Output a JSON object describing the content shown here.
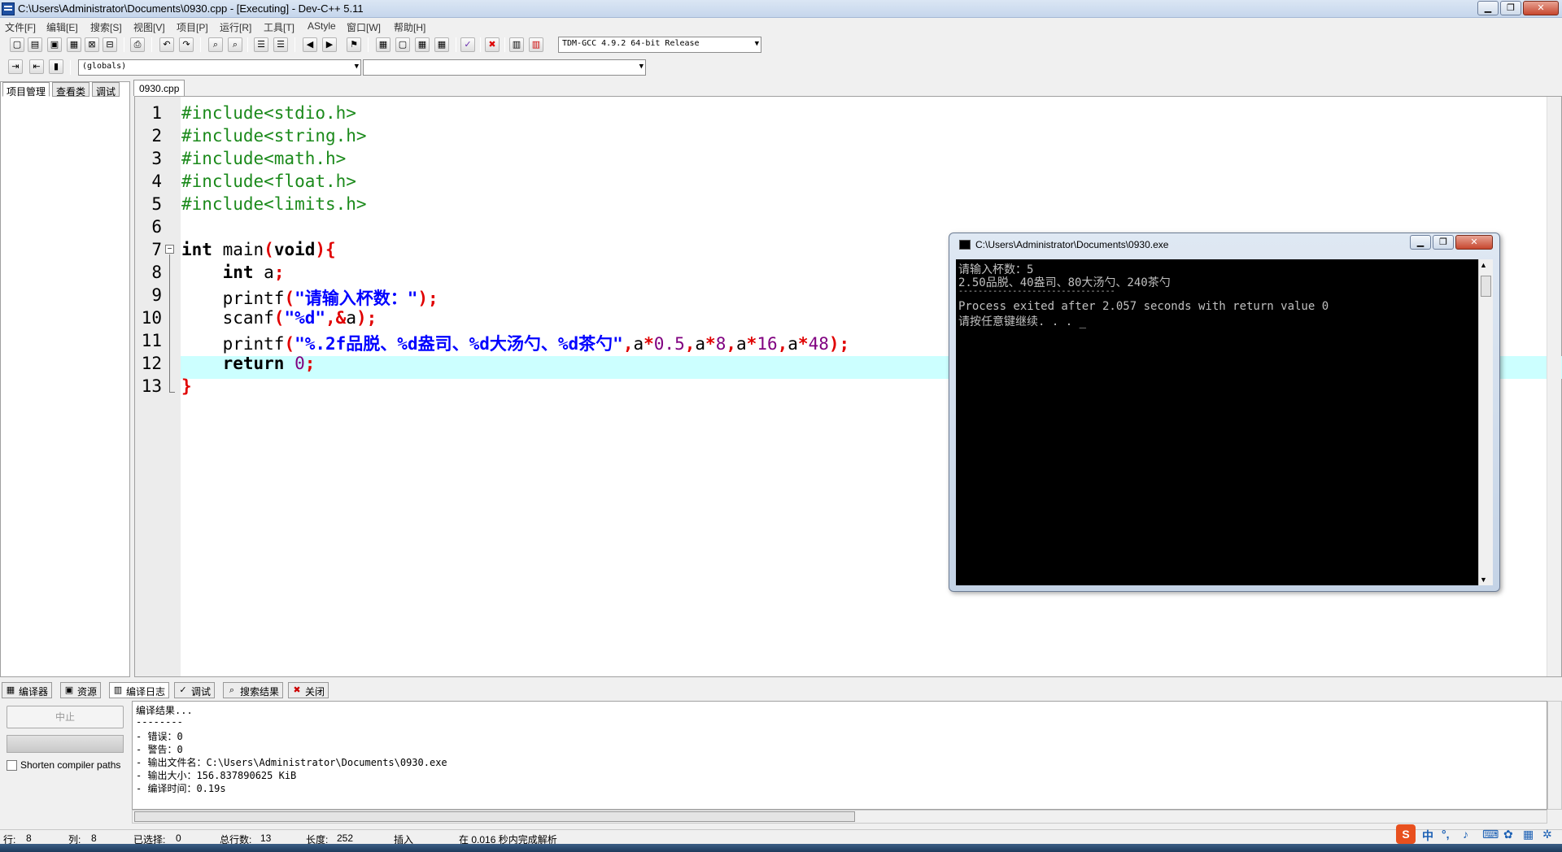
{
  "window": {
    "title": "C:\\Users\\Administrator\\Documents\\0930.cpp - [Executing] - Dev-C++ 5.11",
    "minimize_label": "▁",
    "maximize_label": "❐",
    "close_label": "✕"
  },
  "menu": [
    "文件[F]",
    "编辑[E]",
    "搜索[S]",
    "视图[V]",
    "项目[P]",
    "运行[R]",
    "工具[T]",
    "AStyle",
    "窗口[W]",
    "帮助[H]"
  ],
  "toolbar": {
    "compiler_select": "TDM-GCC 4.9.2 64-bit Release",
    "scope_select": "(globals)",
    "function_select": ""
  },
  "left_panel": {
    "tabs": [
      "项目管理",
      "查看类",
      "调试"
    ]
  },
  "editor": {
    "tab": "0930.cpp",
    "line_numbers": [
      "1",
      "2",
      "3",
      "4",
      "5",
      "6",
      "7",
      "8",
      "9",
      "10",
      "11",
      "12",
      "13"
    ],
    "lines": {
      "l1": "#include<stdio.h>",
      "l2": "#include<string.h>",
      "l3": "#include<math.h>",
      "l4": "#include<float.h>",
      "l5": "#include<limits.h>",
      "l7a": "int",
      "l7b": " main",
      "l7c": "(",
      "l7d": "void",
      "l7e": "){",
      "l8a": "int",
      "l8b": " a",
      "l8c": ";",
      "l9a": "printf",
      "l9b": "(",
      "l9c": "\"请输入杯数：\"",
      "l9d": ");",
      "l10a": "scanf",
      "l10b": "(",
      "l10c": "\"%d\"",
      "l10d": ",&",
      "l10e": "a",
      "l10f": ");",
      "l11a": "printf",
      "l11b": "(",
      "l11c": "\"%.2f品脱、%d盎司、%d大汤勺、%d茶勺\"",
      "l11d": ",",
      "l11e": "a",
      "l11f": "*",
      "l11g": "0.5",
      "l11h": ",",
      "l11i": "a",
      "l11j": "*",
      "l11k": "8",
      "l11l": ",",
      "l11m": "a",
      "l11n": "*",
      "l11o": "16",
      "l11p": ",",
      "l11q": "a",
      "l11r": "*",
      "l11s": "48",
      "l11t": ");",
      "l12a": "return",
      "l12b": " 0",
      "l12c": ";",
      "l13": "}"
    }
  },
  "console": {
    "title": "C:\\Users\\Administrator\\Documents\\0930.exe",
    "lines": [
      "请输入杯数：5",
      "2.50品脱、40盎司、80大汤勺、240茶勺",
      "--------------------------------",
      "Process exited after 2.057 seconds with return value 0",
      "请按任意键继续. . . _"
    ]
  },
  "bottom_tabs": [
    "编译器",
    "资源",
    "编译日志",
    "调试",
    "搜索结果",
    "关闭"
  ],
  "compile": {
    "abort_label": "中止",
    "shorten_label": "Shorten compiler paths",
    "log": [
      "编译结果...",
      "--------",
      "- 错误：0",
      "- 警告：0",
      "- 输出文件名：C:\\Users\\Administrator\\Documents\\0930.exe",
      "- 输出大小：156.837890625 KiB",
      "- 编译时间：0.19s"
    ]
  },
  "status": {
    "row_label": "行:",
    "row": "8",
    "col_label": "列:",
    "col": "8",
    "sel_label": "已选择:",
    "sel": "0",
    "total_label": "总行数:",
    "total": "13",
    "len_label": "长度:",
    "len": "252",
    "mode": "插入",
    "parse": "在 0.016 秒内完成解析"
  },
  "ime": {
    "lang": "中"
  },
  "colors": {
    "preprocessor": "#1b8a1b",
    "string": "#0000ff",
    "symbol": "#e00000",
    "number": "#800080",
    "highlight": "#ccffff"
  }
}
